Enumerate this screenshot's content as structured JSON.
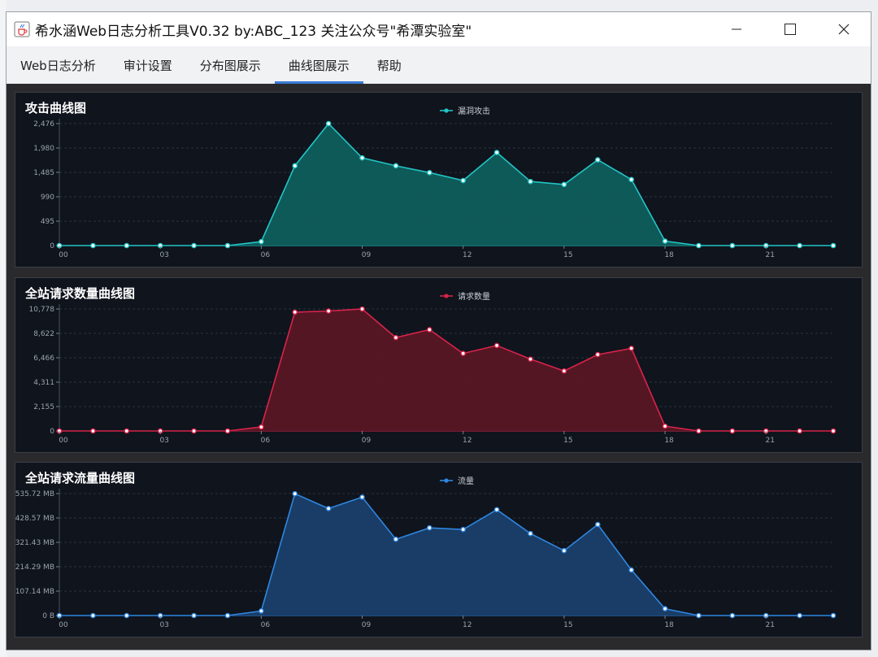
{
  "window": {
    "title": "希水涵Web日志分析工具V0.32 by:ABC_123 关注公众号\"希潭实验室\"",
    "icons": {
      "app": "java-cup-icon",
      "minimize": "minimize-icon",
      "maximize": "maximize-icon",
      "close": "close-icon"
    }
  },
  "menu": {
    "tabs": [
      {
        "label": "Web日志分析",
        "active": false
      },
      {
        "label": "审计设置",
        "active": false
      },
      {
        "label": "分布图展示",
        "active": false
      },
      {
        "label": "曲线图展示",
        "active": true
      },
      {
        "label": "帮助",
        "active": false
      }
    ]
  },
  "colors": {
    "attack": "#22c5c5",
    "attack_fill": "#0f5e5c",
    "requests": "#d9234a",
    "requests_fill": "#5a1625",
    "traffic": "#2f86e0",
    "traffic_fill": "#1a3f6b",
    "panel_bg": "#0f141d"
  },
  "charts": [
    {
      "title": "攻击曲线图",
      "chart_data": {
        "type": "area",
        "x": [
          "00",
          "01",
          "02",
          "03",
          "04",
          "05",
          "06",
          "07",
          "08",
          "09",
          "10",
          "11",
          "12",
          "13",
          "14",
          "15",
          "16",
          "17",
          "18",
          "19",
          "20",
          "21",
          "22",
          "23"
        ],
        "x_tick_labels": [
          "00",
          "03",
          "06",
          "09",
          "12",
          "15",
          "18",
          "21"
        ],
        "series": [
          {
            "name": "漏洞攻击",
            "values": [
              0,
              0,
              0,
              0,
              0,
              0,
              80,
              1620,
              2476,
              1780,
              1620,
              1480,
              1320,
              1890,
              1300,
              1240,
              1740,
              1340,
              90,
              0,
              0,
              0,
              0,
              0
            ]
          }
        ],
        "ylim": [
          0,
          2476
        ],
        "y_tick_labels": [
          "0",
          "495",
          "990",
          "1,485",
          "1,980",
          "2,476"
        ],
        "legend": "top-center",
        "grid": true
      }
    },
    {
      "title": "全站请求数量曲线图",
      "chart_data": {
        "type": "area",
        "x": [
          "00",
          "01",
          "02",
          "03",
          "04",
          "05",
          "06",
          "07",
          "08",
          "09",
          "10",
          "11",
          "12",
          "13",
          "14",
          "15",
          "16",
          "17",
          "18",
          "19",
          "20",
          "21",
          "22",
          "23"
        ],
        "x_tick_labels": [
          "00",
          "03",
          "06",
          "09",
          "12",
          "15",
          "18",
          "21"
        ],
        "series": [
          {
            "name": "请求数量",
            "values": [
              0,
              0,
              0,
              0,
              0,
              0,
              350,
              10500,
              10600,
              10778,
              8250,
              8950,
              6850,
              7550,
              6350,
              5300,
              6750,
              7300,
              420,
              0,
              0,
              0,
              0,
              0
            ]
          }
        ],
        "ylim": [
          0,
          10778
        ],
        "y_tick_labels": [
          "0",
          "2,155",
          "4,311",
          "6,466",
          "8,622",
          "10,778"
        ],
        "legend": "top-center",
        "grid": true
      }
    },
    {
      "title": "全站请求流量曲线图",
      "chart_data": {
        "type": "area",
        "x": [
          "00",
          "01",
          "02",
          "03",
          "04",
          "05",
          "06",
          "07",
          "08",
          "09",
          "10",
          "11",
          "12",
          "13",
          "14",
          "15",
          "16",
          "17",
          "18",
          "19",
          "20",
          "21",
          "22",
          "23"
        ],
        "x_tick_labels": [
          "00",
          "03",
          "06",
          "09",
          "12",
          "15",
          "18",
          "21"
        ],
        "series": [
          {
            "name": "流量",
            "unit": "MB",
            "values": [
              0,
              0,
              0,
              0,
              0,
              0,
              20,
              535,
              470,
              520,
              335,
              385,
              378,
              465,
              360,
              285,
              400,
              200,
              30,
              0,
              0,
              0,
              0,
              0
            ]
          }
        ],
        "ylim": [
          0,
          535.72
        ],
        "y_tick_labels": [
          "0 B",
          "107.14 MB",
          "214.29 MB",
          "321.43 MB",
          "428.57 MB",
          "535.72 MB"
        ],
        "legend": "top-center",
        "grid": true
      }
    }
  ]
}
